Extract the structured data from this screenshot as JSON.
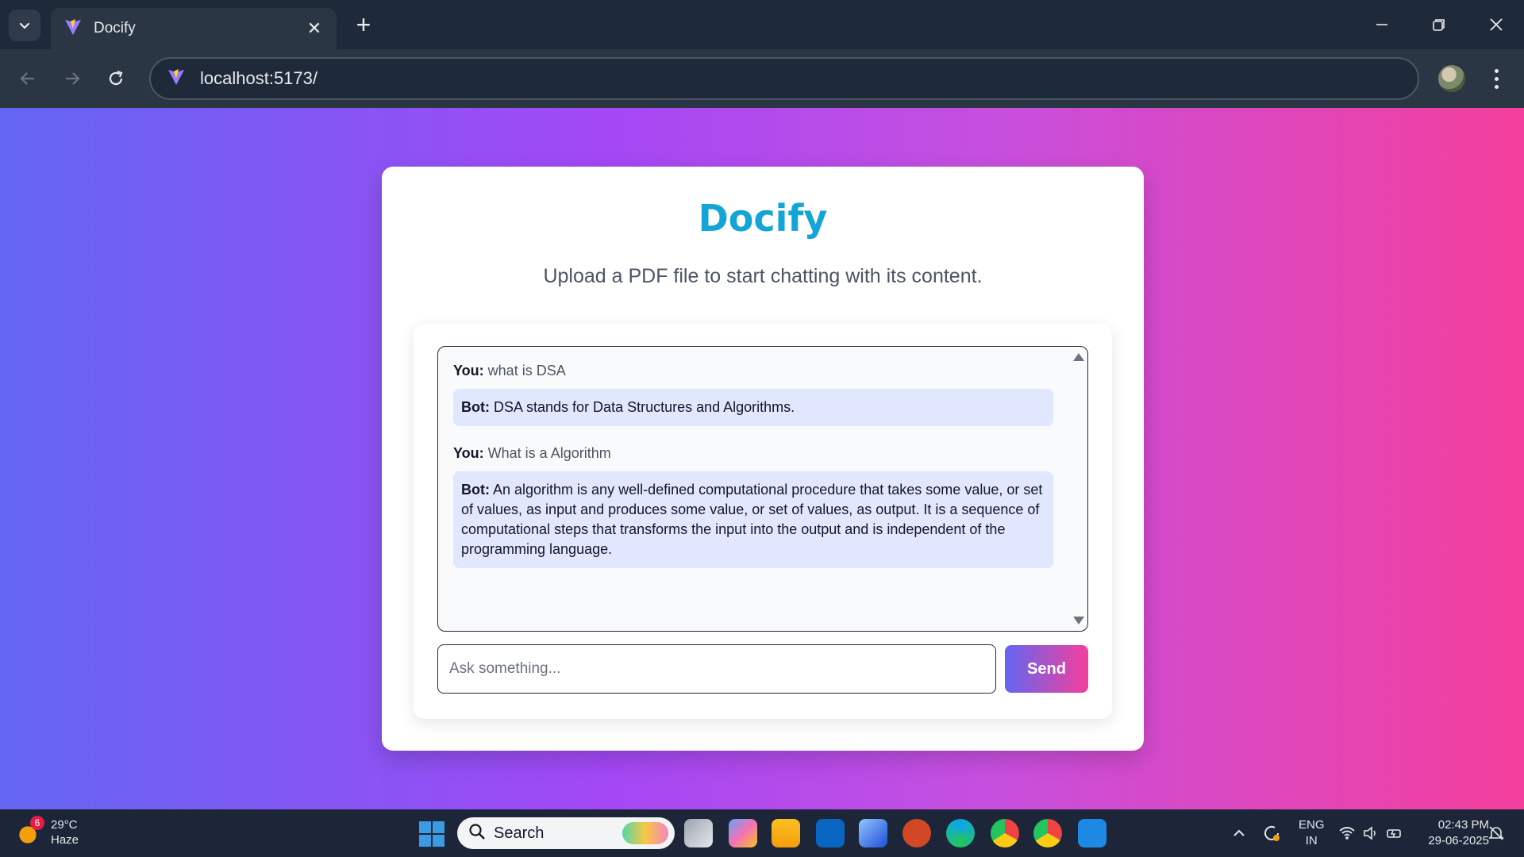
{
  "browser": {
    "tab_title": "Docify",
    "url": "localhost:5173/",
    "new_tab_symbol": "+",
    "close_tab_symbol": "✕"
  },
  "app": {
    "title": "Docify",
    "subtitle": "Upload a PDF file to start chatting with its content.",
    "messages": [
      {
        "role": "user",
        "label": "You:",
        "text": "what is DSA"
      },
      {
        "role": "bot",
        "label": "Bot:",
        "text": "DSA stands for Data Structures and Algorithms."
      },
      {
        "role": "user",
        "label": "You:",
        "text": "What is a Algorithm"
      },
      {
        "role": "bot",
        "label": "Bot:",
        "text": "An algorithm is any well-defined computational procedure that takes some value, or set of values, as input and produces some value, or set of values, as output. It is a sequence of computational steps that transforms the input into the output and is independent of the programming language."
      }
    ],
    "input_placeholder": "Ask something...",
    "send_label": "Send"
  },
  "taskbar": {
    "weather_badge": "6",
    "temperature": "29°C",
    "condition": "Haze",
    "search_label": "Search",
    "language_line1": "ENG",
    "language_line2": "IN",
    "time": "02:43 PM",
    "date": "29-06-2025"
  },
  "colors": {
    "title": "#14a5d8",
    "gradient_start": "#6366f1",
    "gradient_end": "#f43f9c",
    "bot_bubble": "#e0e7ff"
  },
  "icons": [
    "tab-list-icon",
    "vite-logo-icon",
    "close-icon",
    "plus-icon",
    "minimize-icon",
    "restore-icon",
    "window-close-icon",
    "back-icon",
    "forward-icon",
    "reload-icon",
    "profile-avatar",
    "more-icon",
    "scroll-up-icon",
    "scroll-down-icon",
    "weather-icon",
    "windows-start-icon",
    "search-icon",
    "task-view-icon",
    "copilot-icon",
    "file-explorer-icon",
    "outlook-icon",
    "photos-icon",
    "powerpoint-icon",
    "edge-icon",
    "chrome-icon",
    "chrome-profile-icon",
    "vscode-icon",
    "tray-chevron-icon",
    "sync-icon",
    "wifi-icon",
    "volume-icon",
    "battery-icon",
    "notification-icon"
  ]
}
